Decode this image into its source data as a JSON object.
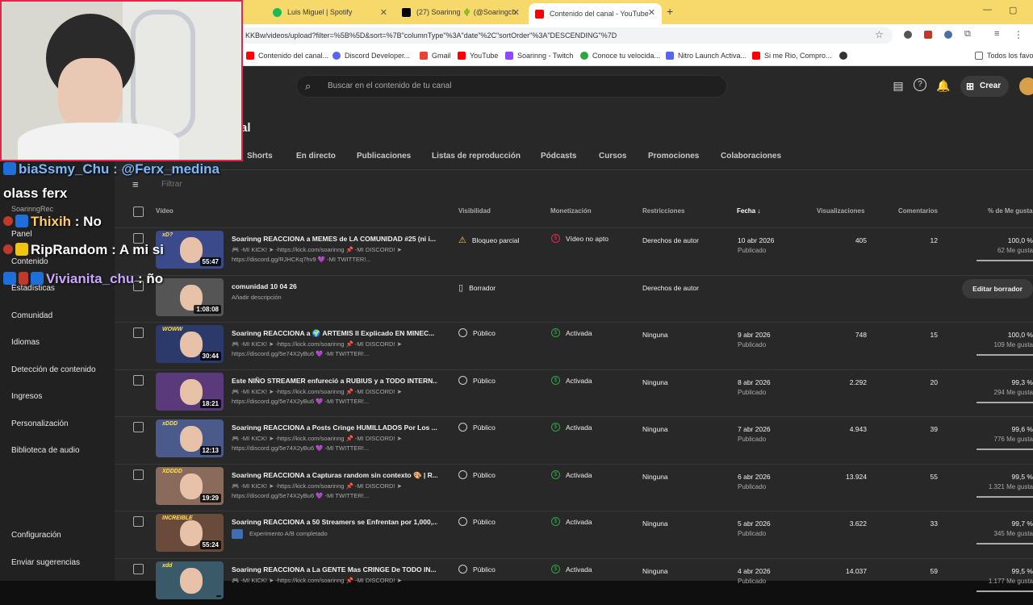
{
  "browser": {
    "tabs": [
      {
        "label": "Luis Miguel | Spotify",
        "color": "#1db954"
      },
      {
        "label": "(27) Soarinng 🌵 (@Soaringch",
        "color": "#000000"
      },
      {
        "label": "Contenido del canal - YouTube",
        "color": "#ff0000"
      }
    ],
    "new_tab": "+",
    "url": "KKBw/videos/upload?filter=%5B%5D&sort=%7B\"columnType\"%3A\"date\"%2C\"sortOrder\"%3A\"DESCENDING\"%7D",
    "bookmarks": [
      {
        "label": "Contenido del canal...",
        "color": "#ff0000"
      },
      {
        "label": "Discord Developer...",
        "color": "#5865f2"
      },
      {
        "label": "Gmail",
        "color": "#ea4335"
      },
      {
        "label": "YouTube",
        "color": "#ff0000"
      },
      {
        "label": "Soarinng - Twitch",
        "color": "#9146ff"
      },
      {
        "label": "Conoce tu velocida...",
        "color": "#2ba640"
      },
      {
        "label": "Nitro Launch Activa...",
        "color": "#5865f2"
      },
      {
        "label": "Si me Rio, Compro...",
        "color": "#ff0000"
      },
      {
        "label": "",
        "color": "#333333"
      }
    ],
    "all_bookmarks": "Todos los favor"
  },
  "studio": {
    "search_placeholder": "Buscar en el contenido de tu canal",
    "create_label": "Crear",
    "page_title_partial": "al"
  },
  "sidebar": {
    "items": [
      "Panel",
      "Contenido",
      "Estadísticas",
      "Comunidad",
      "Idiomas",
      "Detección de contenido",
      "Ingresos",
      "Personalización",
      "Biblioteca de audio"
    ],
    "bottom": [
      "Configuración",
      "Enviar sugerencias"
    ],
    "channel_sub": "SoarinngRec"
  },
  "content_tabs": [
    "Shorts",
    "En directo",
    "Publicaciones",
    "Listas de reproducción",
    "Pódcasts",
    "Cursos",
    "Promociones",
    "Colaboraciones"
  ],
  "filter_label": "Filtrar",
  "table": {
    "headers": [
      "Vídeo",
      "Visibilidad",
      "Monetización",
      "Restricciones",
      "Fecha",
      "Visualizaciones",
      "Comentarios",
      "% de Me gusta"
    ],
    "rows": [
      {
        "title": "Soarinng REACCIONA a MEMES de LA COMUNIDAD #25 (ni i...",
        "desc1": "🎮 -MI KICK! ➤ -https://kick.com/soarinng 📌 -MI DISCORD! ➤",
        "desc2": "https://discord.gg/RJHCKq7hv9 💜 -MI TWITTER!...",
        "duration": "55:47",
        "badge": "xD?",
        "visibility": "Bloqueo parcial",
        "monet": "Vídeo no apto",
        "restr": "Derechos de autor",
        "date": "10 abr 2026",
        "status": "Publicado",
        "views": "405",
        "comments": "12",
        "likes": "100,0 %",
        "likes_sub": "62 Me gusta",
        "like_frac": 1.0,
        "thumb": "#3a4a8a"
      },
      {
        "title": "comunidad 10 04 26",
        "desc1": "Añadir descripción",
        "desc2": "",
        "duration": "1:08:08",
        "badge": "",
        "visibility": "Borrador",
        "monet": "",
        "restr": "Derechos de autor",
        "date": "",
        "status": "",
        "views": "",
        "comments": "",
        "likes": "",
        "likes_sub": "",
        "action": "Editar borrador",
        "thumb": "#555555"
      },
      {
        "title": "Soarinng REACCIONA a 🌍 ARTEMIS II Explicado EN MINEC...",
        "desc1": "🎮 -MI KICK! ➤ -https://kick.com/soarinng 📌 -MI DISCORD! ➤",
        "desc2": "https://discord.gg/5e74X2yBu6 💜 -MI TWITTER!...",
        "duration": "30:44",
        "badge": "WOWW",
        "visibility": "Público",
        "monet": "Activada",
        "restr": "Ninguna",
        "date": "9 abr 2026",
        "status": "Publicado",
        "views": "748",
        "comments": "15",
        "likes": "100,0 %",
        "likes_sub": "109 Me gusta",
        "like_frac": 1.0,
        "thumb": "#2b3a6a"
      },
      {
        "title": "Este NIÑO STREAMER enfureció a RUBIUS y a TODO INTERN...",
        "desc1": "🎮 -MI KICK! ➤ -https://kick.com/soarinng 📌 -MI DISCORD! ➤",
        "desc2": "https://discord.gg/5e74X2yBu6 💜 -MI TWITTER!...",
        "duration": "18:21",
        "badge": "",
        "visibility": "Público",
        "monet": "Activada",
        "restr": "Ninguna",
        "date": "8 abr 2026",
        "status": "Publicado",
        "views": "2.292",
        "comments": "20",
        "likes": "99,3 %",
        "likes_sub": "294 Me gusta",
        "like_frac": 0.993,
        "thumb": "#5a3a7a"
      },
      {
        "title": "Soarinng REACCIONA a Posts Cringe HUMILLADOS Por Los ...",
        "desc1": "🎮 -MI KICK! ➤ -https://kick.com/soarinng 📌 -MI DISCORD! ➤",
        "desc2": "https://discord.gg/5e74X2yBu6 💜 -MI TWITTER!...",
        "duration": "12:13",
        "badge": "xDDD",
        "visibility": "Público",
        "monet": "Activada",
        "restr": "Ninguna",
        "date": "7 abr 2026",
        "status": "Publicado",
        "views": "4.943",
        "comments": "39",
        "likes": "99,6 %",
        "likes_sub": "776 Me gusta",
        "like_frac": 0.996,
        "thumb": "#4a5a8a"
      },
      {
        "title": "Soarinng REACCIONA a Capturas random sin contexto 🎨 | R...",
        "desc1": "🎮 -MI KICK! ➤ -https://kick.com/soarinng 📌 -MI DISCORD! ➤",
        "desc2": "https://discord.gg/5e74X2yBu6 💜 -MI TWITTER!...",
        "duration": "19:29",
        "badge": "XDDDD",
        "visibility": "Público",
        "monet": "Activada",
        "restr": "Ninguna",
        "date": "6 abr 2026",
        "status": "Publicado",
        "views": "13.924",
        "comments": "55",
        "likes": "99,5 %",
        "likes_sub": "1.321 Me gusta",
        "like_frac": 0.995,
        "thumb": "#8a6a5a"
      },
      {
        "title": "Soarinng REACCIONA a 50 Streamers se Enfrentan por 1,000,...",
        "desc1": "Experimento A/B completado",
        "desc2": "",
        "duration": "55:24",
        "badge": "INCREIBLE",
        "visibility": "Público",
        "monet": "Activada",
        "restr": "Ninguna",
        "date": "5 abr 2026",
        "status": "Publicado",
        "views": "3.622",
        "comments": "33",
        "likes": "99,7 %",
        "likes_sub": "345 Me gusta",
        "like_frac": 0.997,
        "thumb": "#6a4a3a"
      },
      {
        "title": "Soarinng REACCIONA a La GENTE Mas CRINGE De TODO IN...",
        "desc1": "🎮 -MI KICK! ➤ -https://kick.com/soarinng 📌 -MI DISCORD! ➤",
        "desc2": "",
        "duration": "",
        "badge": "xdd",
        "visibility": "Público",
        "monet": "Activada",
        "restr": "Ninguna",
        "date": "4 abr 2026",
        "status": "Publicado",
        "views": "14.037",
        "comments": "59",
        "likes": "99,5 %",
        "likes_sub": "1.177 Me gusta",
        "like_frac": 0.995,
        "thumb": "#3a5a6a"
      }
    ]
  },
  "overlay": {
    "chat": [
      {
        "user": "biaSsmy_Chu",
        "msg": " : @Ferx_medina",
        "color": "#7ab8ff"
      },
      {
        "user": "olass ferx",
        "msg": "",
        "color": "#ffffff"
      },
      {
        "user": "Thixih",
        "msg": " : No",
        "color": "#ffcc66"
      },
      {
        "user": "RipRandom",
        "msg": " : A mi si",
        "color": "#ffffff"
      },
      {
        "user": "Vivianita_chu",
        "msg": " : ño",
        "color": "#c8a8ff"
      }
    ]
  }
}
